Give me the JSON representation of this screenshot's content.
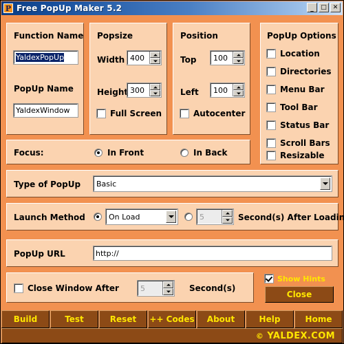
{
  "window": {
    "title": "Free PopUp Maker 5.2",
    "icon": "app-p-icon",
    "minimize": "_",
    "maximize": "□",
    "close": "✕"
  },
  "function_panel": {
    "title": "Function Name",
    "function_name_value": "YaldexPopUp",
    "popup_name_label": "PopUp Name",
    "popup_name_value": "YaldexWindow"
  },
  "popsize_panel": {
    "title": "Popsize",
    "width_label": "Width",
    "width_value": "400",
    "height_label": "Height",
    "height_value": "300",
    "fullscreen_label": "Full Screen",
    "fullscreen_checked": false
  },
  "position_panel": {
    "title": "Position",
    "top_label": "Top",
    "top_value": "100",
    "left_label": "Left",
    "left_value": "100",
    "autocenter_label": "Autocenter",
    "autocenter_checked": false
  },
  "popup_options": {
    "title": "PopUp Options",
    "items": [
      {
        "label": "Location",
        "accel": "o",
        "checked": false
      },
      {
        "label": "Directories",
        "accel": "i",
        "checked": false
      },
      {
        "label": "Menu Bar",
        "accel": "M",
        "checked": false
      },
      {
        "label": "Tool Bar",
        "accel": "l",
        "checked": false
      },
      {
        "label": "Status Bar",
        "accel": "B",
        "checked": false
      },
      {
        "label": "Scroll Bars",
        "accel": "c",
        "checked": false
      },
      {
        "label": "Resizable",
        "accel": "e",
        "checked": false
      }
    ]
  },
  "focus": {
    "label": "Focus:",
    "in_front": "In Front",
    "in_back": "In Back",
    "selected": "In Front"
  },
  "type_of_popup": {
    "label": "Type of PopUp",
    "value": "Basic"
  },
  "launch_method": {
    "label": "Launch Method",
    "mode_value": "On Load",
    "mode_selected": true,
    "delay_selected": false,
    "delay_value": "5",
    "delay_label": "Second(s) After Loading"
  },
  "popup_url": {
    "label": "PopUp URL",
    "value": "http://"
  },
  "close_window": {
    "label": "Close Window After",
    "checked": false,
    "seconds_value": "5",
    "seconds_label": "Second(s)"
  },
  "hints": {
    "label": "Show Hints",
    "checked": true,
    "close_button": "Close"
  },
  "toolbar": {
    "buttons": [
      "Build",
      "Test",
      "Reset",
      "++ Codes",
      "About",
      "Help",
      "Home"
    ]
  },
  "statusbar": {
    "copyright_symbol": "©",
    "text": "YALDEX.COM"
  },
  "colors": {
    "window_bg": "#f29150",
    "panel_bg": "#fbd3b0",
    "toolbar_brown": "#8c4a16",
    "accent_yellow": "#ffe600",
    "title_blue": "#0a3c82",
    "selection_blue": "#0a246a"
  }
}
